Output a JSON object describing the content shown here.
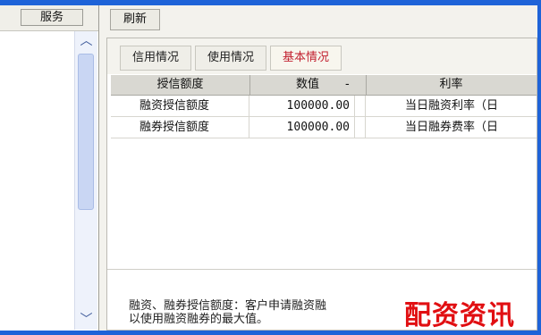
{
  "left_panel": {
    "service_label": "服务"
  },
  "toolbar": {
    "refresh_label": "刷新"
  },
  "tabs": [
    {
      "label": "信用情况",
      "active": false
    },
    {
      "label": "使用情况",
      "active": false
    },
    {
      "label": "基本情况",
      "active": true
    }
  ],
  "table": {
    "columns": [
      "授信额度",
      "数值",
      "-",
      "利率"
    ],
    "rows": [
      {
        "name": "融资授信额度",
        "value": "100000.00",
        "rate": "当日融资利率（日"
      },
      {
        "name": "融券授信额度",
        "value": "100000.00",
        "rate": "当日融券费率（日"
      }
    ]
  },
  "description": {
    "line1": "融资、融券授信额度：客户申请融资融",
    "line2": "以使用融资融券的最大值。"
  },
  "watermark": "配资资讯",
  "colors": {
    "frame_blue": "#1e63d8",
    "active_tab": "#c2202f",
    "watermark_red": "#e10f12"
  }
}
